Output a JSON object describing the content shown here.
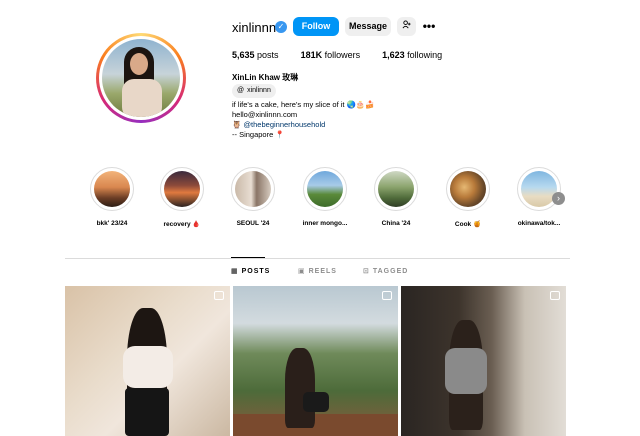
{
  "profile": {
    "username": "xinlinnn",
    "full_name": "XinLin Khaw 玫琳",
    "threads_handle": "xinlinnn",
    "verified": true,
    "avatar_icon": "profile-photo"
  },
  "actions": {
    "follow_label": "Follow",
    "message_label": "Message",
    "add_user_icon": "person-plus-icon",
    "more_icon": "ellipsis-icon"
  },
  "stats": {
    "posts": "5,635",
    "posts_label": "posts",
    "followers": "181K",
    "followers_label": "followers",
    "following": "1,623",
    "following_label": "following"
  },
  "bio": {
    "line1": "if life's a cake, here's my slice of it 🌏🎂🍰",
    "line2": "hello@xinlinnn.com",
    "line3_prefix": "🦉",
    "line3_link": "@thebeginnerhousehold",
    "line4": "-- Singapore 📍"
  },
  "highlights": [
    {
      "label": "bkk' 23/24"
    },
    {
      "label": "recovery 🩸"
    },
    {
      "label": "SEOUL '24"
    },
    {
      "label": "inner mongo..."
    },
    {
      "label": "China '24"
    },
    {
      "label": "Cook 🍯"
    },
    {
      "label": "okinawa/tok..."
    }
  ],
  "tabs": [
    {
      "label": "POSTS",
      "icon": "grid-icon",
      "active": true
    },
    {
      "label": "REELS",
      "icon": "reels-icon",
      "active": false
    },
    {
      "label": "TAGGED",
      "icon": "tag-icon",
      "active": false
    }
  ],
  "colors": {
    "accent": "#0095f6",
    "verified": "#3897f0",
    "link": "#00376b"
  }
}
